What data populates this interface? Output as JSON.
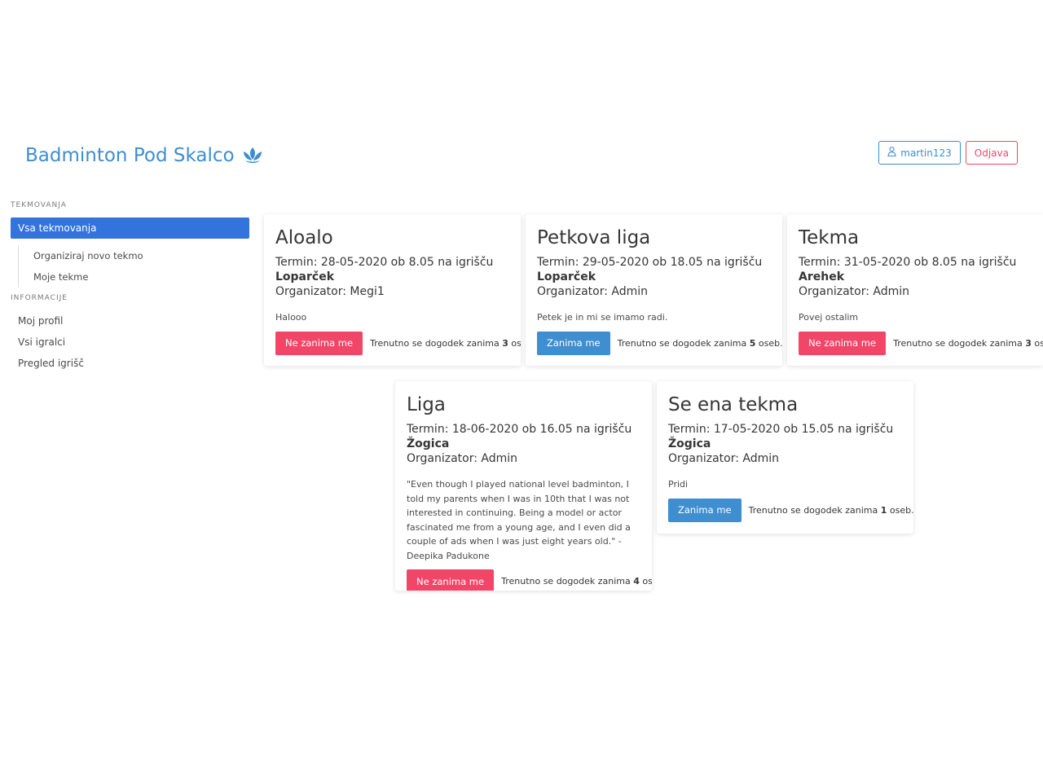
{
  "brand": {
    "title": "Badminton Pod Skalco",
    "icon": "spa-icon",
    "color": "#3e8ed0"
  },
  "top": {
    "user_label": "martin123",
    "logout_label": "Odjava"
  },
  "menu": {
    "label_competitions": "Tekmovanja",
    "all": "Vsa tekmovanja",
    "sub": [
      "Organiziraj novo tekmo",
      "Moje tekme"
    ],
    "label_info": "Informacije",
    "info": [
      "Moj profil",
      "Vsi igralci",
      "Pregled igrišč"
    ]
  },
  "events": [
    {
      "title": "Aloalo",
      "termin": "Termin: 28-05-2020 ob 8.05 na igrišču",
      "venue": "Loparček",
      "organizer": "Organizator: Megi1",
      "description": "Halooo",
      "button": "Ne zanima me",
      "button_type": "danger",
      "interest_prefix": "Trenutno se dogodek zanima ",
      "count": "3",
      "interest_suffix": " oseb."
    },
    {
      "title": "Petkova liga",
      "termin": "Termin: 29-05-2020 ob 18.05 na igrišču",
      "venue": "Loparček",
      "organizer": "Organizator: Admin",
      "description": "Petek je in mi se imamo radi.",
      "button": "Zanima me",
      "button_type": "info",
      "interest_prefix": "Trenutno se dogodek zanima ",
      "count": "5",
      "interest_suffix": " oseb."
    },
    {
      "title": "Tekma",
      "termin": "Termin: 31-05-2020 ob 8.05 na igrišču",
      "venue": "Arehek",
      "organizer": "Organizator: Admin",
      "description": "Povej ostalim",
      "button": "Ne zanima me",
      "button_type": "danger",
      "interest_prefix": "Trenutno se dogodek zanima ",
      "count": "3",
      "interest_suffix": " oseb."
    },
    {
      "title": "Liga",
      "termin": "Termin: 18-06-2020 ob 16.05 na igrišču",
      "venue": "Žogica",
      "organizer": "Organizator: Admin",
      "description": "\"Even though I played national level badminton, I told my parents when I was in 10th that I was not interested in continuing. Being a model or actor fascinated me from a young age, and I even did a couple of ads when I was just eight years old.\" - Deepika Padukone",
      "button": "Ne zanima me",
      "button_type": "danger",
      "interest_prefix": "Trenutno se dogodek zanima ",
      "count": "4",
      "interest_suffix": " oseb."
    },
    {
      "title": "Se ena tekma",
      "termin": "Termin: 17-05-2020 ob 15.05 na igrišču",
      "venue": "Žogica",
      "organizer": "Organizator: Admin",
      "description": "Pridi",
      "button": "Zanima me",
      "button_type": "info",
      "interest_prefix": "Trenutno se dogodek zanima ",
      "count": "1",
      "interest_suffix": " oseb."
    }
  ]
}
